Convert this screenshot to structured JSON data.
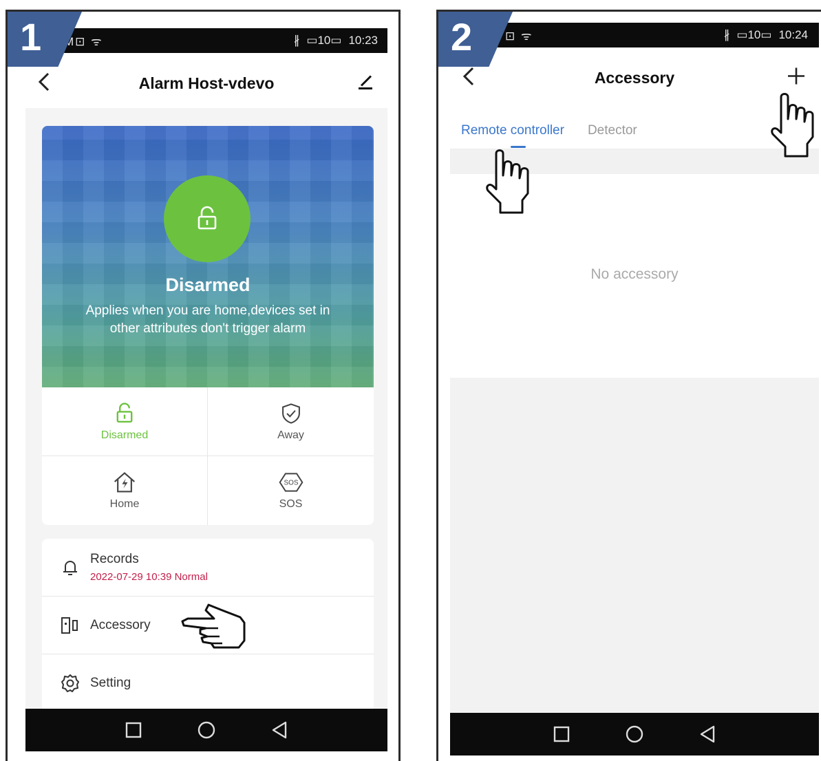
{
  "panel1": {
    "step_number": "1",
    "status_bar": {
      "left": "M⊡ ᯤ",
      "bluetooth": "∦",
      "battery": "▭10▭",
      "time": "10:23"
    },
    "header": {
      "title": "Alarm Host-vdevo"
    },
    "hero": {
      "title": "Disarmed",
      "description": "Applies when you are home,devices set in other attributes  don't trigger alarm"
    },
    "modes": [
      {
        "label": "Disarmed",
        "icon": "unlock-icon",
        "active": true
      },
      {
        "label": "Away",
        "icon": "shield-check-icon",
        "active": false
      },
      {
        "label": "Home",
        "icon": "home-bolt-icon",
        "active": false
      },
      {
        "label": "SOS",
        "icon": "sos-icon",
        "active": false
      }
    ],
    "menu": {
      "records_label": "Records",
      "records_sub": "2022-07-29 10:39 Normal",
      "accessory_label": "Accessory",
      "setting_label": "Setting"
    },
    "colors": {
      "active_green": "#6cc23f",
      "record_red": "#c21e4a",
      "badge": "#3f5f95"
    }
  },
  "panel2": {
    "step_number": "2",
    "status_bar": {
      "left": "⊡ ᯤ",
      "bluetooth": "∦",
      "battery": "▭10▭",
      "time": "10:24"
    },
    "header": {
      "title": "Accessory"
    },
    "tabs": [
      {
        "label": "Remote controller",
        "active": true
      },
      {
        "label": "Detector",
        "active": false
      }
    ],
    "empty_text": "No accessory",
    "colors": {
      "tab_active": "#3a77cc"
    }
  }
}
